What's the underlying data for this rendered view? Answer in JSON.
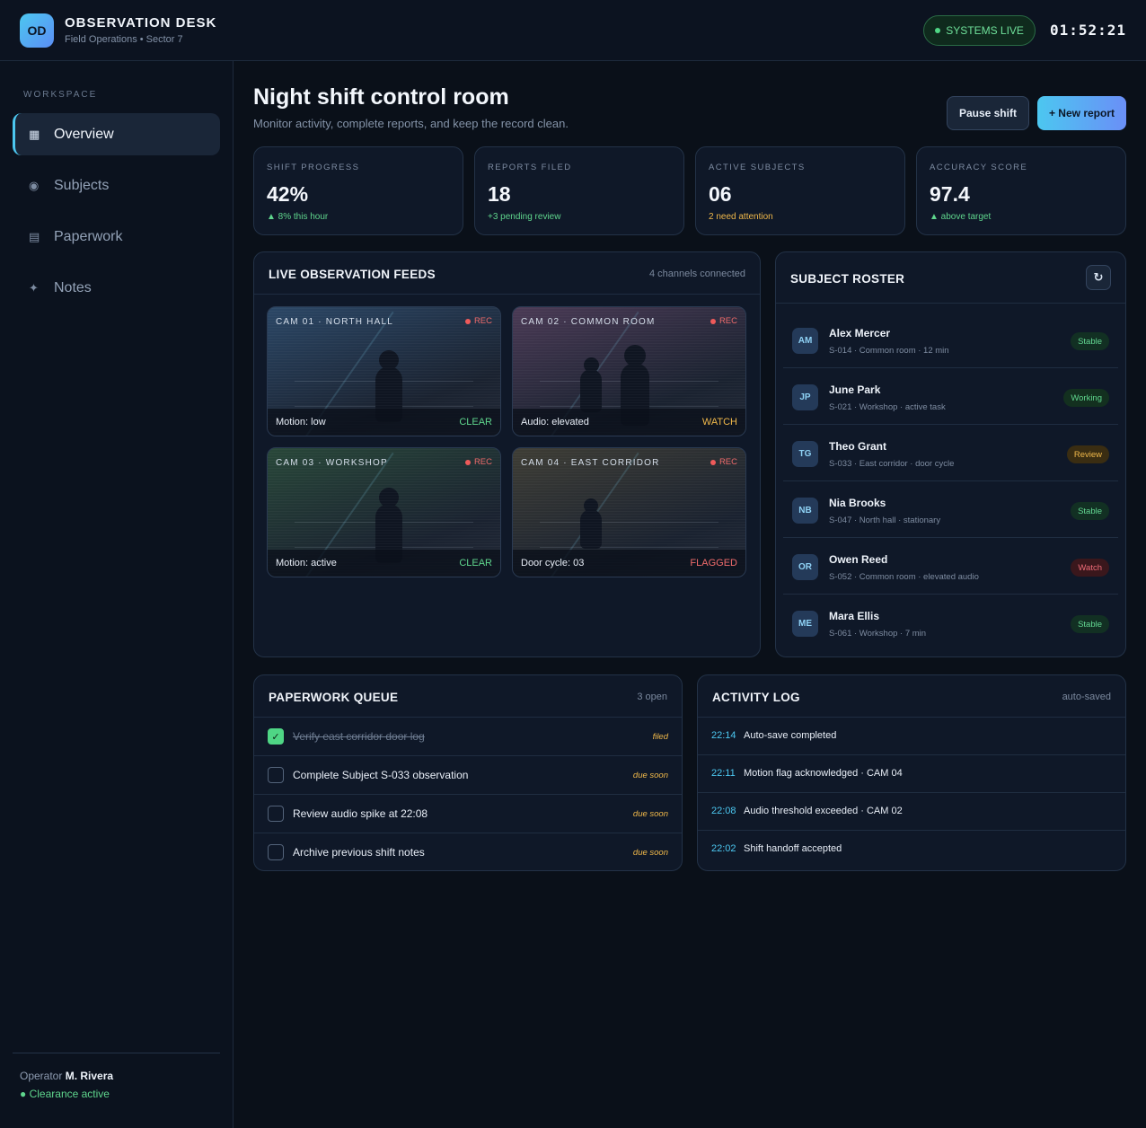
{
  "header": {
    "logo": "OD",
    "title": "OBSERVATION DESK",
    "subtitle": "Field Operations • Sector 7",
    "status": "SYSTEMS LIVE",
    "clock": "01:52:21"
  },
  "sidebar": {
    "section_label": "WORKSPACE",
    "items": [
      {
        "label": "Overview",
        "icon": "grid-icon",
        "glyph": "▦",
        "active": true
      },
      {
        "label": "Subjects",
        "icon": "target-icon",
        "glyph": "◉",
        "active": false
      },
      {
        "label": "Paperwork",
        "icon": "document-icon",
        "glyph": "▤",
        "active": false
      },
      {
        "label": "Notes",
        "icon": "sparkle-icon",
        "glyph": "✦",
        "active": false
      }
    ],
    "operator_prefix": "Operator",
    "operator_name": "M. Rivera",
    "clearance": "Clearance active"
  },
  "page": {
    "title": "Night shift control room",
    "subtitle": "Monitor activity, complete reports, and keep the record clean.",
    "pause_label": "Pause shift",
    "new_report_label": "+ New report"
  },
  "stats": [
    {
      "label": "SHIFT PROGRESS",
      "value": "42%",
      "note": "▲ 8% this hour",
      "tone": "green"
    },
    {
      "label": "REPORTS FILED",
      "value": "18",
      "note": "+3 pending review",
      "tone": "green"
    },
    {
      "label": "ACTIVE SUBJECTS",
      "value": "06",
      "note": "2 need attention",
      "tone": "amber"
    },
    {
      "label": "ACCURACY SCORE",
      "value": "97.4",
      "note": "▲ above target",
      "tone": "green"
    }
  ],
  "feeds": {
    "title": "LIVE OBSERVATION FEEDS",
    "meta": "4 channels connected",
    "rec_label": "REC",
    "cams": [
      {
        "name": "CAM 01 · NORTH HALL",
        "reading": "Motion: low",
        "status": "CLEAR",
        "status_color": "#5fd68d",
        "tint": "#2b4766"
      },
      {
        "name": "CAM 02 · COMMON ROOM",
        "reading": "Audio: elevated",
        "status": "WATCH",
        "status_color": "#f0b84a",
        "tint": "#4a3a55"
      },
      {
        "name": "CAM 03 · WORKSHOP",
        "reading": "Motion: active",
        "status": "CLEAR",
        "status_color": "#5fd68d",
        "tint": "#284739"
      },
      {
        "name": "CAM 04 · EAST CORRIDOR",
        "reading": "Door cycle: 03",
        "status": "FLAGGED",
        "status_color": "#ef6b6b",
        "tint": "#3e3d35"
      }
    ]
  },
  "roster": {
    "title": "SUBJECT ROSTER",
    "refresh_icon": "↻",
    "subjects": [
      {
        "initials": "AM",
        "name": "Alex Mercer",
        "detail": "S-014 · Common room · 12 min",
        "status": "Stable",
        "cls": "b-stable"
      },
      {
        "initials": "JP",
        "name": "June Park",
        "detail": "S-021 · Workshop · active task",
        "status": "Working",
        "cls": "b-working"
      },
      {
        "initials": "TG",
        "name": "Theo Grant",
        "detail": "S-033 · East corridor · door cycle",
        "status": "Review",
        "cls": "b-review"
      },
      {
        "initials": "NB",
        "name": "Nia Brooks",
        "detail": "S-047 · North hall · stationary",
        "status": "Stable",
        "cls": "b-stable"
      },
      {
        "initials": "OR",
        "name": "Owen Reed",
        "detail": "S-052 · Common room · elevated audio",
        "status": "Watch",
        "cls": "b-watch"
      },
      {
        "initials": "ME",
        "name": "Mara Ellis",
        "detail": "S-061 · Workshop · 7 min",
        "status": "Stable",
        "cls": "b-stable"
      }
    ]
  },
  "paperwork": {
    "title": "PAPERWORK QUEUE",
    "meta": "3 open",
    "items": [
      {
        "text": "Verify east corridor door log",
        "tag": "filed",
        "done": true
      },
      {
        "text": "Complete Subject S-033 observation",
        "tag": "due soon",
        "done": false
      },
      {
        "text": "Review audio spike at 22:08",
        "tag": "due soon",
        "done": false
      },
      {
        "text": "Archive previous shift notes",
        "tag": "due soon",
        "done": false
      }
    ]
  },
  "activity": {
    "title": "ACTIVITY LOG",
    "meta": "auto-saved",
    "entries": [
      {
        "time": "22:14",
        "text": "Auto-save completed"
      },
      {
        "time": "22:11",
        "text": "Motion flag acknowledged · CAM 04"
      },
      {
        "time": "22:08",
        "text": "Audio threshold exceeded · CAM 02"
      },
      {
        "time": "22:02",
        "text": "Shift handoff accepted"
      }
    ]
  }
}
